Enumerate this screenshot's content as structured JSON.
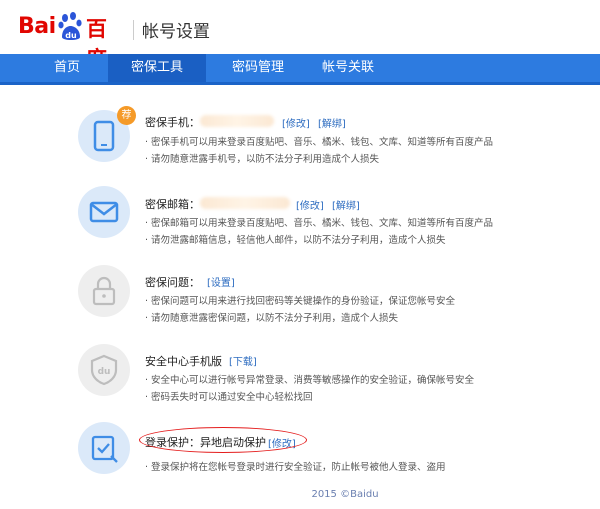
{
  "header": {
    "logo_left": "Bai",
    "logo_paw": "du",
    "logo_right": "百度",
    "title": "帐号设置"
  },
  "nav": {
    "items": [
      {
        "label": "首页"
      },
      {
        "label": "密保工具",
        "active": true
      },
      {
        "label": "密码管理"
      },
      {
        "label": "帐号关联"
      }
    ]
  },
  "sections": [
    {
      "title": "密保手机：",
      "links": [
        "[修改]",
        "[解绑]"
      ],
      "badge": "荐",
      "icon": "phone-icon",
      "lines": [
        "· 密保手机可以用来登录百度贴吧、音乐、橘米、钱包、文库、知道等所有百度产品",
        "· 请勿随意泄露手机号，以防不法分子利用造成个人损失"
      ]
    },
    {
      "title": "密保邮箱：",
      "links": [
        "[修改]",
        "[解绑]"
      ],
      "icon": "mail-icon",
      "lines": [
        "· 密保邮箱可以用来登录百度贴吧、音乐、橘米、钱包、文库、知道等所有百度产品",
        "· 请勿泄露邮箱信息，轻信他人邮件，以防不法分子利用，造成个人损失"
      ]
    },
    {
      "title": "密保问题：",
      "links": [
        "[设置]"
      ],
      "icon": "lock-question-icon",
      "lines": [
        "· 密保问题可以用来进行找回密码等关键操作的身份验证，保证您帐号安全",
        "· 请勿随意泄露密保问题，以防不法分子利用，造成个人损失"
      ]
    },
    {
      "title": "安全中心手机版",
      "links": [
        "[下载]"
      ],
      "icon": "shield-du-icon",
      "lines": [
        "· 安全中心可以进行帐号异常登录、消费等敏感操作的安全验证，确保帐号安全",
        "· 密码丢失时可以通过安全中心轻松找回"
      ]
    },
    {
      "title": "登录保护：异地启动保护",
      "links": [
        "[修改]"
      ],
      "icon": "login-check-icon",
      "lines": [
        "· 登录保护将在您帐号登录时进行安全验证，防止帐号被他人登录、盗用"
      ]
    }
  ],
  "footer": "2015 ©Baidu",
  "colors": {
    "brand_red": "#e10601",
    "nav_blue": "#2d7be0",
    "nav_active": "#1a5fc3",
    "link_blue": "#2d6cc0",
    "badge_orange": "#f59a28",
    "highlight_red": "#e41c1c"
  }
}
